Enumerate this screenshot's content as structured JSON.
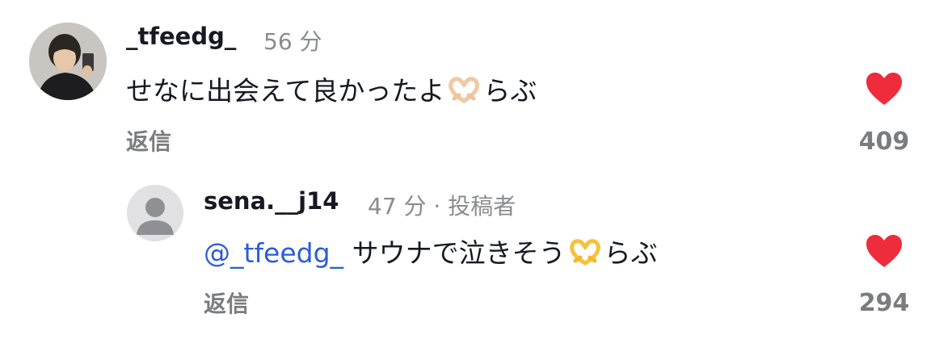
{
  "comments": [
    {
      "username": "_tfeedg_",
      "time": "56 分",
      "text_before_emoji": "せなに出会えて良かったよ",
      "emoji": "heart-hands",
      "text_after_emoji": "らぶ",
      "reply_label": "返信",
      "like_count": "409"
    }
  ],
  "replies": [
    {
      "username": "sena.__j14",
      "time": "47 分 · 投稿者",
      "mention": "@_tfeedg_",
      "text_before_emoji": "サウナで泣きそう",
      "emoji": "heart-hands",
      "text_after_emoji": "らぶ",
      "reply_label": "返信",
      "like_count": "294"
    }
  ],
  "colors": {
    "heart": "#ee2c3c",
    "mention": "#2b5dd6",
    "muted": "#8a8b91"
  }
}
